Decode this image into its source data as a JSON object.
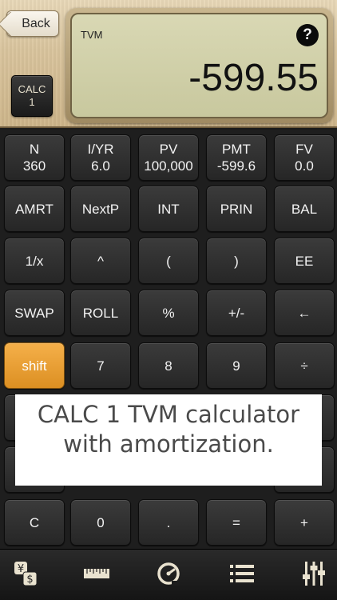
{
  "header": {
    "back_label": "Back",
    "badge": {
      "line1": "CALC",
      "line2": "1"
    }
  },
  "display": {
    "mode": "TVM",
    "value": "-599.55",
    "help_glyph": "?"
  },
  "keypad": {
    "rows": [
      [
        {
          "label": "N",
          "sub": "360"
        },
        {
          "label": "I/YR",
          "sub": "6.0"
        },
        {
          "label": "PV",
          "sub": "100,000"
        },
        {
          "label": "PMT",
          "sub": "-599.6"
        },
        {
          "label": "FV",
          "sub": "0.0"
        }
      ],
      [
        {
          "label": "AMRT"
        },
        {
          "label": "NextP"
        },
        {
          "label": "INT"
        },
        {
          "label": "PRIN"
        },
        {
          "label": "BAL"
        }
      ],
      [
        {
          "label": "1/x"
        },
        {
          "label": "^"
        },
        {
          "label": "("
        },
        {
          "label": ")"
        },
        {
          "label": "EE"
        }
      ],
      [
        {
          "label": "SWAP"
        },
        {
          "label": "ROLL"
        },
        {
          "label": "%"
        },
        {
          "label": "+/-"
        },
        {
          "label": "←"
        }
      ],
      [
        {
          "label": "shift"
        },
        {
          "label": "7"
        },
        {
          "label": "8"
        },
        {
          "label": "9"
        },
        {
          "label": "÷"
        }
      ],
      [
        {
          "label": "C"
        },
        {
          "label": "0"
        },
        {
          "label": "."
        },
        {
          "label": "="
        },
        {
          "label": "+"
        }
      ]
    ]
  },
  "caption": {
    "line1": "CALC 1 TVM calculator",
    "line2": "with amortization."
  },
  "tabbar": {
    "icons": [
      "currency-exchange-icon",
      "ruler-icon",
      "speedometer-icon",
      "list-icon",
      "sliders-icon"
    ],
    "accent": "#e9e2cf"
  },
  "colors": {
    "shift_key": "#e89a2c",
    "key_bg": "#2f2f2f",
    "lcd_bg": "#d1d0a9"
  }
}
